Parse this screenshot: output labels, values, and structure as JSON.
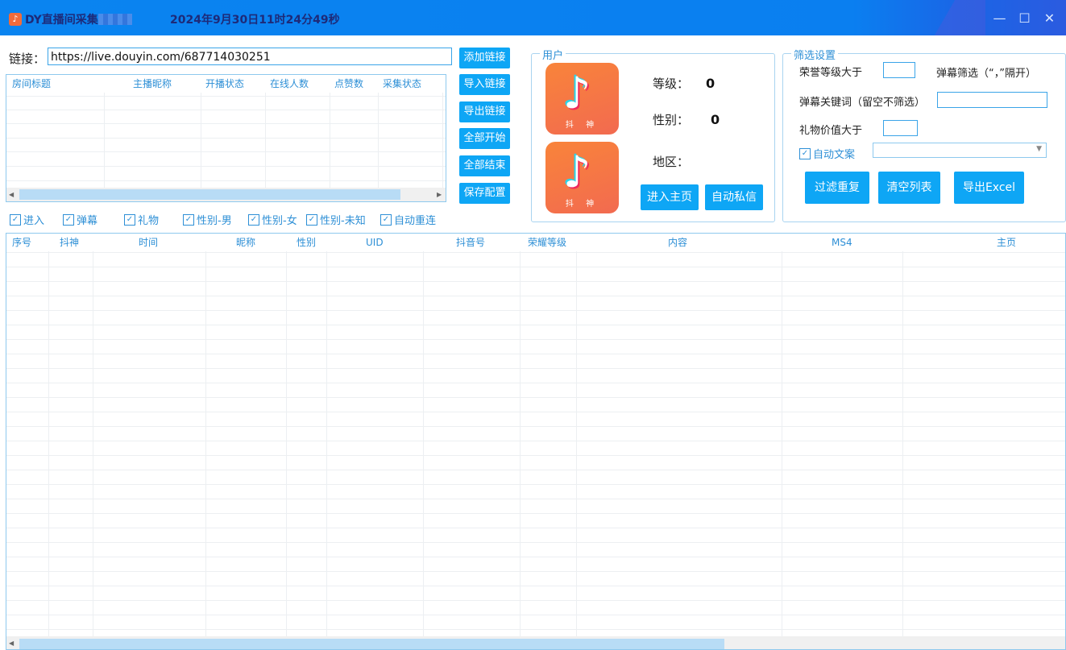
{
  "window": {
    "title": "DY直播间采集",
    "datetime": "2024年9月30日11时24分49秒",
    "controls": [
      "minimize-icon",
      "maximize-icon",
      "close-icon"
    ]
  },
  "link": {
    "label": "链接：",
    "value": "https://live.douyin.com/687714030251"
  },
  "link_buttons": [
    "添加链接",
    "导入链接",
    "导出链接",
    "全部开始",
    "全部结束",
    "保存配置"
  ],
  "room_table": {
    "columns": [
      "房间标题",
      "主播昵称",
      "开播状态",
      "在线人数",
      "点赞数",
      "采集状态"
    ]
  },
  "filters": [
    {
      "label": "进入",
      "checked": true
    },
    {
      "label": "弹幕",
      "checked": true
    },
    {
      "label": "礼物",
      "checked": true
    },
    {
      "label": "性别-男",
      "checked": true
    },
    {
      "label": "性别-女",
      "checked": true
    },
    {
      "label": "性别-未知",
      "checked": true
    },
    {
      "label": "自动重连",
      "checked": true
    }
  ],
  "user": {
    "legend": "用户",
    "avatar_caption": "抖 神",
    "level_label": "等级：",
    "level_value": "0",
    "gender_label": "性别：",
    "gender_value": "0",
    "region_label": "地区：",
    "home_button": "进入主页",
    "dm_button": "自动私信"
  },
  "settings": {
    "legend": "筛选设置",
    "honor_label": "荣誉等级大于",
    "danmu_filter_label": "弹幕筛选（“，”隔开）",
    "keyword_label": "弹幕关键词（留空不筛选）",
    "gift_label": "礼物价值大于",
    "auto_text_label": "自动文案",
    "auto_text_checked": true,
    "dedupe_button": "过滤重复",
    "clear_button": "清空列表",
    "export_button": "导出Excel"
  },
  "main_table": {
    "columns": [
      "序号",
      "抖神",
      "时间",
      "昵称",
      "性别",
      "UID",
      "抖音号",
      "荣耀等级",
      "内容",
      "MS4",
      "主页"
    ]
  },
  "colors": {
    "titlebar": "#0a84f0",
    "accent": "#0ea6f5",
    "header_text": "#2d8fd6",
    "border": "#8ec9ee"
  }
}
